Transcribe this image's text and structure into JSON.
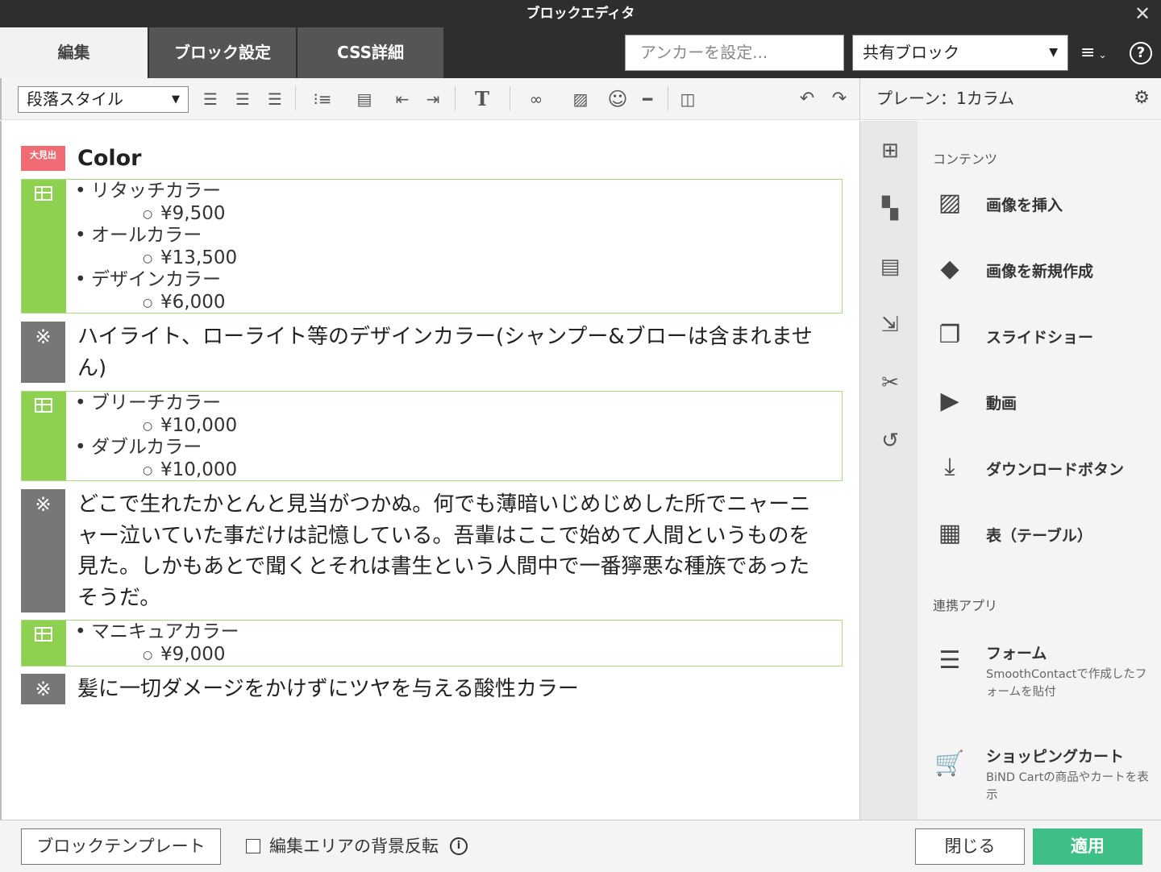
{
  "window": {
    "title": "ブロックエディタ",
    "close_glyph": "✕"
  },
  "tabs": [
    {
      "label": "編集",
      "active": true
    },
    {
      "label": "ブロック設定",
      "active": false
    },
    {
      "label": "CSS詳細",
      "active": false
    }
  ],
  "header": {
    "anchor_placeholder": "アンカーを設定...",
    "shared_block": "共有ブロック"
  },
  "toolbar": {
    "paragraph_style": "段落スタイル"
  },
  "side_header": {
    "label": "プレーン：1カラム"
  },
  "content": {
    "heading_tag": "大見出",
    "heading": "Color",
    "list1": [
      {
        "item": "リタッチカラー",
        "price": "¥9,500"
      },
      {
        "item": "オールカラー",
        "price": "¥13,500"
      },
      {
        "item": "デザインカラー",
        "price": "¥6,000"
      }
    ],
    "note1": "ハイライト、ローライト等のデザインカラー(シャンプー&ブローは含まれません)",
    "list2": [
      {
        "item": "ブリーチカラー",
        "price": "¥10,000"
      },
      {
        "item": "ダブルカラー",
        "price": "¥10,000"
      }
    ],
    "note2": "どこで生れたかとんと見当がつかぬ。何でも薄暗いじめじめした所でニャーニャー泣いていた事だけは記憶している。吾輩はここで始めて人間というものを見た。しかもあとで聞くとそれは書生という人間中で一番獰悪な種族であったそうだ。",
    "list3": [
      {
        "item": "マニキュアカラー",
        "price": "¥9,000"
      }
    ],
    "note3": "髪に一切ダメージをかけずにツヤを与える酸性カラー",
    "note_glyph": "※"
  },
  "panel": {
    "contents_title": "コンテンツ",
    "items": [
      {
        "label": "画像を挿入",
        "icon": "image-icon"
      },
      {
        "label": "画像を新規作成",
        "icon": "shapes-icon"
      },
      {
        "label": "スライドショー",
        "icon": "slideshow-icon"
      },
      {
        "label": "動画",
        "icon": "video-icon"
      },
      {
        "label": "ダウンロードボタン",
        "icon": "download-icon"
      },
      {
        "label": "表（テーブル）",
        "icon": "table-icon"
      }
    ],
    "apps_title": "連携アプリ",
    "apps": [
      {
        "label": "フォーム",
        "sub": "SmoothContactで作成したフォームを貼付",
        "icon": "form-icon"
      },
      {
        "label": "ショッピングカート",
        "sub": "BiND Cartの商品やカートを表示",
        "icon": "cart-icon"
      }
    ]
  },
  "footer": {
    "template_button": "ブロックテンプレート",
    "invert_label": "編集エリアの背景反転",
    "close_button": "閉じる",
    "apply_button": "適用"
  }
}
